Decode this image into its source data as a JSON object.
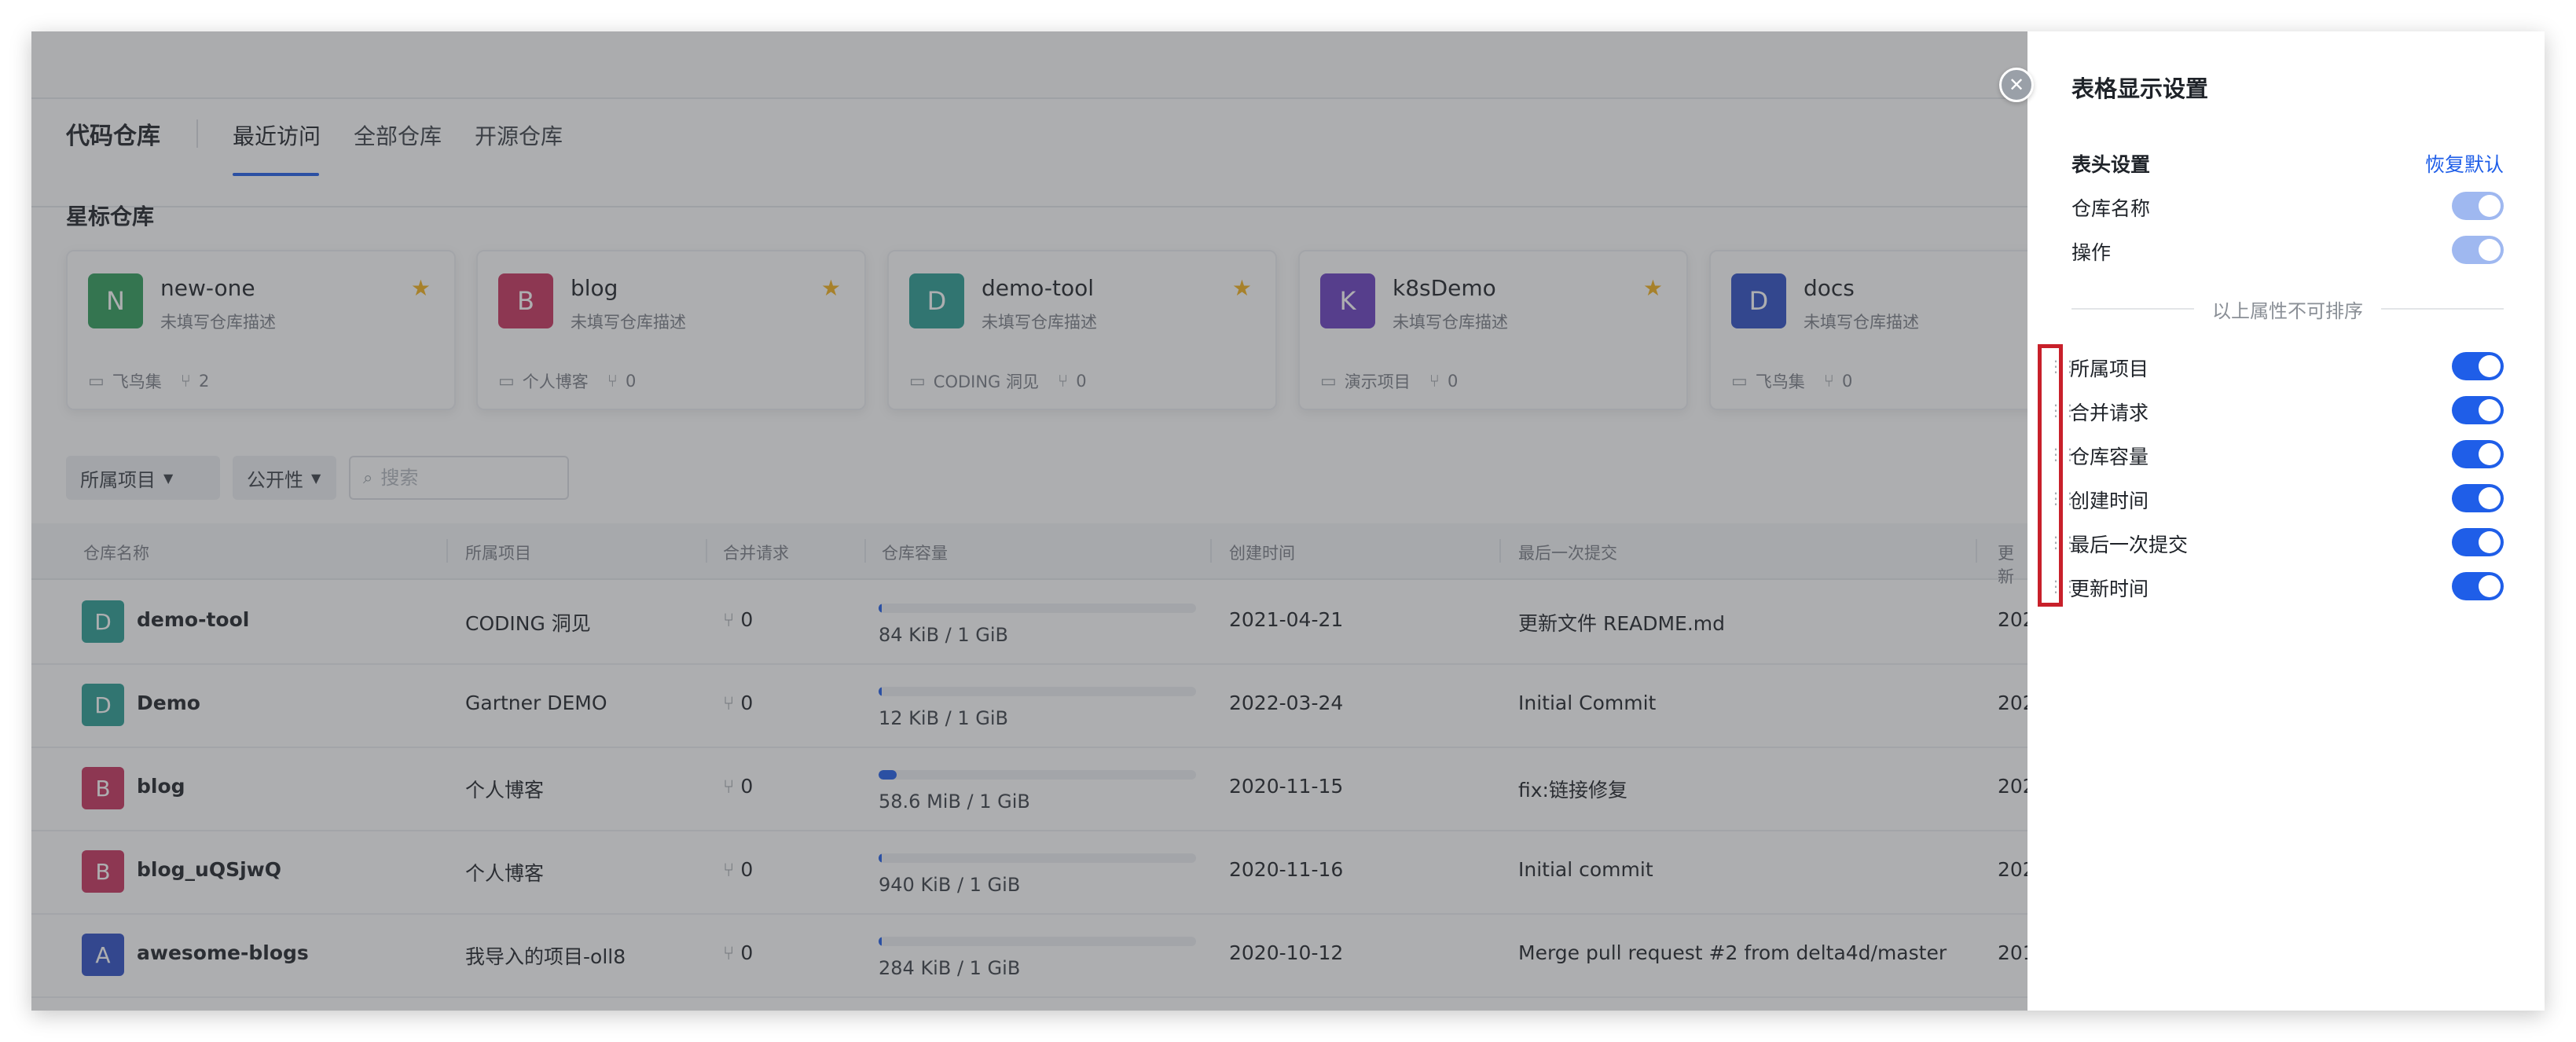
{
  "app": {
    "title": "代码仓库",
    "tabs": [
      {
        "label": "最近访问",
        "active": true
      },
      {
        "label": "全部仓库",
        "active": false
      },
      {
        "label": "开源仓库",
        "active": false
      }
    ]
  },
  "starred": {
    "title": "星标仓库",
    "cards": [
      {
        "initial": "N",
        "name": "new-one",
        "desc": "未填写仓库描述",
        "project": "飞鸟集",
        "mr": "2",
        "color": "#2f9e5a"
      },
      {
        "initial": "B",
        "name": "blog",
        "desc": "未填写仓库描述",
        "project": "个人博客",
        "mr": "0",
        "color": "#c8325e"
      },
      {
        "initial": "D",
        "name": "demo-tool",
        "desc": "未填写仓库描述",
        "project": "CODING 洞见",
        "mr": "0",
        "color": "#2a9d93"
      },
      {
        "initial": "K",
        "name": "k8sDemo",
        "desc": "未填写仓库描述",
        "project": "演示项目",
        "mr": "0",
        "color": "#6a3fc1"
      },
      {
        "initial": "D",
        "name": "docs",
        "desc": "未填写仓库描述",
        "project": "飞鸟集",
        "mr": "0",
        "color": "#2d4fc4"
      }
    ]
  },
  "filters": {
    "project": "所属项目",
    "visibility": "公开性",
    "search_placeholder": "搜索"
  },
  "table": {
    "columns": [
      "仓库名称",
      "所属项目",
      "合并请求",
      "仓库容量",
      "创建时间",
      "最后一次提交",
      "更新"
    ],
    "rows": [
      {
        "initial": "D",
        "name": "demo-tool",
        "project": "CODING 洞见",
        "mr": "0",
        "capacity": "84 KiB / 1 GiB",
        "usage": 0.01,
        "created": "2021-04-21",
        "last_commit": "更新文件 README.md",
        "updated": "202",
        "color": "#2a9d93"
      },
      {
        "initial": "D",
        "name": "Demo",
        "project": "Gartner DEMO",
        "mr": "0",
        "capacity": "12 KiB / 1 GiB",
        "usage": 0.01,
        "created": "2022-03-24",
        "last_commit": "Initial Commit",
        "updated": "202",
        "color": "#2a9d93"
      },
      {
        "initial": "B",
        "name": "blog",
        "project": "个人博客",
        "mr": "0",
        "capacity": "58.6 MiB / 1 GiB",
        "usage": 0.057,
        "created": "2020-11-15",
        "last_commit": "fix:链接修复",
        "updated": "202",
        "color": "#c8325e"
      },
      {
        "initial": "B",
        "name": "blog_uQSjwQ",
        "project": "个人博客",
        "mr": "0",
        "capacity": "940 KiB / 1 GiB",
        "usage": 0.01,
        "created": "2020-11-16",
        "last_commit": "Initial commit",
        "updated": "202",
        "color": "#c8325e"
      },
      {
        "initial": "A",
        "name": "awesome-blogs",
        "project": "我导入的项目-oll8",
        "mr": "0",
        "capacity": "284 KiB / 1 GiB",
        "usage": 0.01,
        "created": "2020-10-12",
        "last_commit": "Merge pull request #2 from delta4d/master",
        "updated": "201",
        "color": "#2d4fc4"
      }
    ]
  },
  "drawer": {
    "title": "表格显示设置",
    "header_label": "表头设置",
    "reset_label": "恢复默认",
    "fixed_columns": [
      "仓库名称",
      "操作"
    ],
    "divider_text": "以上属性不可排序",
    "sortable_columns": [
      "所属项目",
      "合并请求",
      "仓库容量",
      "创建时间",
      "最后一次提交",
      "更新时间"
    ]
  },
  "colors": {
    "accent": "#1f5ee8",
    "star": "#f5b21b",
    "highlight": "#c8202a"
  }
}
